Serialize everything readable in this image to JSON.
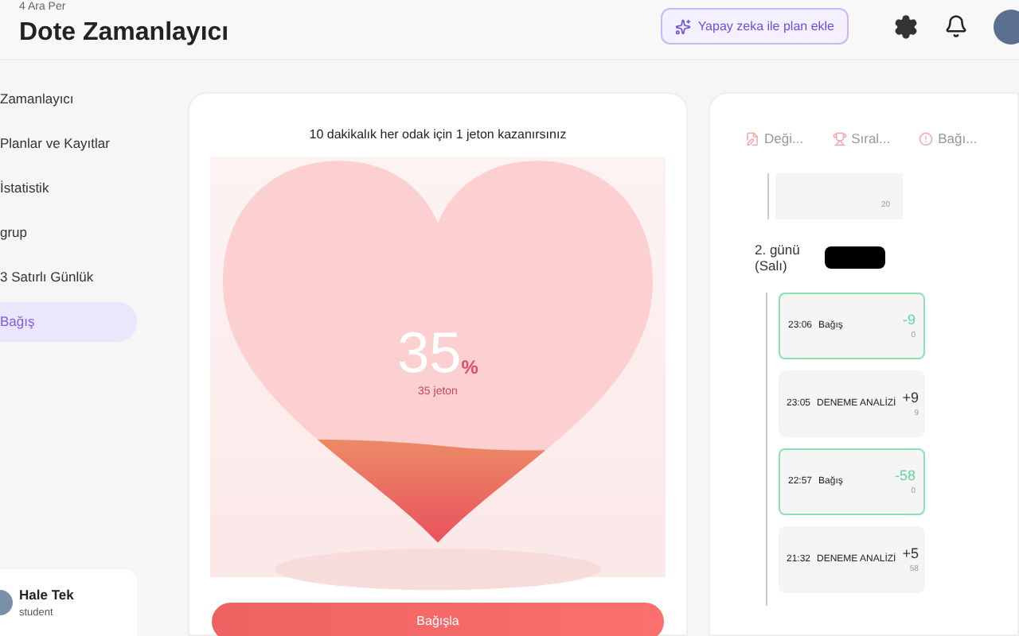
{
  "status_bar": {
    "date": "4 Ara Per"
  },
  "header": {
    "title": "Dote Zamanlayıcı",
    "ai_button": "Yapay zeka ile plan ekle"
  },
  "sidebar": {
    "items": [
      {
        "label": "Zamanlayıcı",
        "selected": false
      },
      {
        "label": "Planlar ve Kayıtlar",
        "selected": false
      },
      {
        "label": "İstatistik",
        "selected": false
      },
      {
        "label": "grup",
        "selected": false
      },
      {
        "label": "3 Satırlı Günlük",
        "selected": false
      },
      {
        "label": "Bağış",
        "selected": true
      }
    ],
    "user": {
      "name": "Hale Tek",
      "role": "student"
    }
  },
  "donation": {
    "info": "10 dakikalık her odak için 1 jeton kazanırsınız",
    "level": 0.35,
    "percent": "35",
    "percent_unit": "%",
    "tokens": "35 jeton",
    "button": "Bağışla"
  },
  "history": {
    "tabs": [
      {
        "label": "Deği...",
        "selected": false
      },
      {
        "label": "Sıral...",
        "selected": false
      },
      {
        "label": "Bağı...",
        "selected": false
      }
    ],
    "previous_entry": {
      "count": "20"
    },
    "day": {
      "label": "2. günü",
      "weekday": "(Salı)"
    },
    "entries": [
      {
        "kind": "donation",
        "time": "23:06",
        "title": "Bağış",
        "delta": "-9",
        "count": "0"
      },
      {
        "kind": "study",
        "time": "23:05",
        "title": "DENEME ANALİZİ",
        "delta": "+9",
        "count": "9"
      },
      {
        "kind": "donation",
        "time": "22:57",
        "title": "Bağış",
        "delta": "-58",
        "count": "0"
      },
      {
        "kind": "study",
        "time": "21:32",
        "title": "DENEME ANALİZİ",
        "delta": "+5",
        "count": "58"
      }
    ]
  }
}
